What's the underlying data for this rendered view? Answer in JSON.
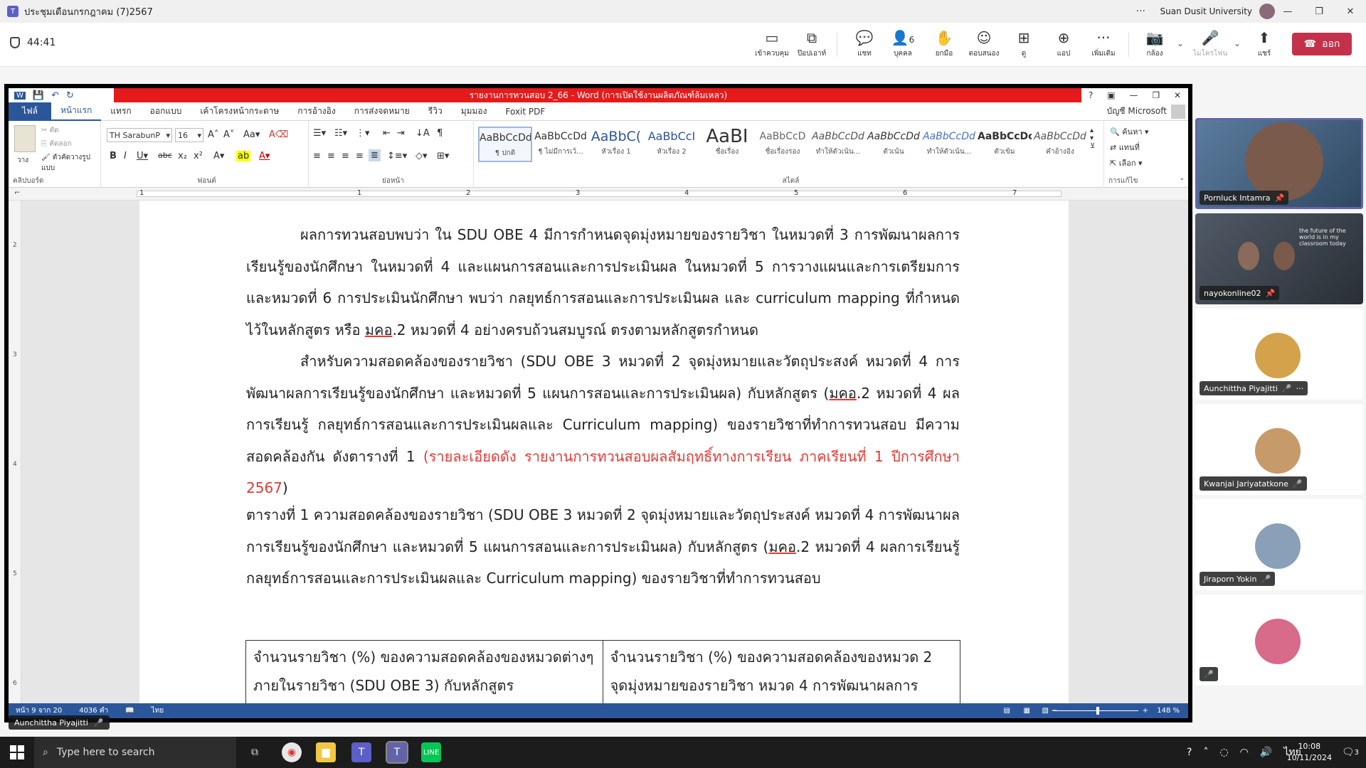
{
  "teams": {
    "title": "ประชุมเดือนกรกฎาคม (7)2567",
    "org": "Suan Dusit University",
    "more": "···",
    "timer": "44:41",
    "toolbar": [
      {
        "id": "take-control",
        "label": "เข้าควบคุม",
        "icon": "▭"
      },
      {
        "id": "popout",
        "label": "ป๊อปเอาท์",
        "icon": "⧉"
      },
      {
        "id": "chat",
        "label": "แชท",
        "icon": "💬"
      },
      {
        "id": "people",
        "label": "บุคคล",
        "icon": "👤",
        "count": "6"
      },
      {
        "id": "raise-hand",
        "label": "ยกมือ",
        "icon": "✋"
      },
      {
        "id": "react",
        "label": "ตอบสนอง",
        "icon": "☺"
      },
      {
        "id": "view",
        "label": "ดู",
        "icon": "⊞"
      },
      {
        "id": "apps",
        "label": "แอป",
        "icon": "⊕"
      },
      {
        "id": "more",
        "label": "เพิ่มเติม",
        "icon": "···"
      },
      {
        "id": "camera",
        "label": "กล้อง",
        "icon": "📷"
      },
      {
        "id": "mic",
        "label": "ไมโครโฟน",
        "icon": "🎤"
      },
      {
        "id": "share",
        "label": "แชร์",
        "icon": "⬆"
      }
    ],
    "leave": "ออก"
  },
  "word": {
    "title": "รายงานการทวนสอบ 2_66 - Word (การเปิดใช้งานผลิตภัณฑ์ล้มเหลว)",
    "tabs": [
      "ไฟล์",
      "หน้าแรก",
      "แทรก",
      "ออกแบบ",
      "เค้าโครงหน้ากระดาษ",
      "การอ้างอิง",
      "การส่งจดหมาย",
      "รีวิว",
      "มุมมอง",
      "Foxit PDF"
    ],
    "account": "บัญชี Microsoft",
    "font_name": "TH SarabunP",
    "font_size": "16",
    "clipboard": {
      "paste": "วาง",
      "cut": "ตัด",
      "copy": "คัดลอก",
      "format_painter": "ตัวคัดวางรูปแบบ",
      "label": "คลิปบอร์ด"
    },
    "group_font": "ฟอนต์",
    "group_paragraph": "ย่อหน้า",
    "group_styles": "สไตล์",
    "group_editing": "การแก้ไข",
    "editing": {
      "find": "ค้นหา",
      "replace": "แทนที่",
      "select": "เลือก"
    },
    "styles": [
      {
        "preview": "AaBbCcDd",
        "name": "¶ ปกติ"
      },
      {
        "preview": "AaBbCcDd",
        "name": "¶ ไม่มีการเว้..."
      },
      {
        "preview": "AaBbC(",
        "name": "หัวเรื่อง 1"
      },
      {
        "preview": "AaBbCcI",
        "name": "หัวเรื่อง 2"
      },
      {
        "preview": "AaBI",
        "name": "ชื่อเรื่อง"
      },
      {
        "preview": "AaBbCcD",
        "name": "ชื่อเรื่องรอง"
      },
      {
        "preview": "AaBbCcDd",
        "name": "ทำให้ตัวเน้น..."
      },
      {
        "preview": "AaBbCcDd",
        "name": "ตัวเน้น"
      },
      {
        "preview": "AaBbCcDd",
        "name": "ทำให้ตัวเน้น..."
      },
      {
        "preview": "AaBbCcDc",
        "name": "ตัวเข้ม"
      },
      {
        "preview": "AaBbCcDd",
        "name": "คำอ้างอิง"
      }
    ],
    "ruler": [
      "1",
      "1",
      "2",
      "3",
      "4",
      "5",
      "6",
      "7"
    ],
    "vruler": [
      "2",
      "3",
      "4",
      "5",
      "6"
    ],
    "doc": {
      "p1": "ผลการทวนสอบพบว่า ใน SDU OBE 4 มีการกำหนดจุดมุ่งหมายของรายวิชา ในหมวดที่ 3 การพัฒนาผลการเรียนรู้ของนักศึกษา ในหมวดที่ 4 และแผนการสอนและการประเมินผล ในหมวดที่ 5 การวางแผนและการเตรียมการ และหมวดที่ 6 การประเมินนักศึกษา พบว่า  กลยุทธ์การสอนและการประเมินผล และ curriculum mapping ที่กำหนดไว้ในหลักสูตร หรือ",
      "p1_u": "มคอ",
      "p1_end": ".2 หมวดที่ 4 อย่างครบถ้วนสมบูรณ์ ตรงตามหลักสูตรกำหนด",
      "p2a": "สำหรับความสอดคล้องของรายวิชา (SDU OBE 3 หมวดที่ 2 จุดมุ่งหมายและวัตถุประสงค์ หมวดที่ 4 การพัฒนาผลการเรียนรู้ของนักศึกษา และหมวดที่ 5 แผนการสอนและการประเมินผล) กับหลักสูตร (",
      "p2_u": "มคอ",
      "p2b": ".2 หมวดที่ 4 ผลการเรียนรู้ กลยุทธ์การสอนและการประเมินผลและ Curriculum mapping) ของรายวิชาที่ทำการทวนสอบ มีความสอดคล้องกัน ดังตารางที่ 1 ",
      "p2_red": "(รายละเอียดดัง รายงานการทวนสอบผลสัมฤทธิ์ทางการเรียน ภาคเรียนที่ 1 ปีการศึกษา 2567",
      "p2_close": ")",
      "p3a": "ตารางที่ 1 ความสอดคล้องของรายวิชา (SDU OBE 3 หมวดที่ 2 จุดมุ่งหมายและวัตถุประสงค์ หมวดที่ 4 การพัฒนาผลการเรียนรู้ของนักศึกษา และหมวดที่ 5 แผนการสอนและการประเมินผล) กับหลักสูตร (",
      "p3_u": "มคอ",
      "p3b": ".2 หมวดที่ 4 ผลการเรียนรู้ กลยุทธ์การสอนและการประเมินผลและ Curriculum mapping) ของรายวิชาที่ทำการทวนสอบ",
      "table_c1": "จำนวนรายวิชา (%) ของความสอดคล้องของหมวดต่างๆ ภายในรายวิชา (SDU OBE 3) กับหลักสูตร",
      "table_c2": "จำนวนรายวิชา (%) ของความสอดคล้องของหมวด 2 จุดมุ่งหมายของรายวิชา หมวด 4 การพัฒนาผลการ"
    },
    "status": {
      "page": "หน้า 9 จาก 20",
      "words": "4036 คำ",
      "lang": "ไทย",
      "zoom": "148 %"
    }
  },
  "presenter_tag": "Aunchittha Piyajitti",
  "participants": [
    {
      "name": "Pornluck Intamra",
      "video": true,
      "color": "#4a6a8a"
    },
    {
      "name": "nayokonline02",
      "video": true,
      "color": "#3b4450"
    },
    {
      "name": "Aunchittha Piyajitti",
      "video": false,
      "color": "#d4a24a",
      "more": "···"
    },
    {
      "name": "Kwanjai Jariyatatkone",
      "video": false,
      "color": "#c79a6a"
    },
    {
      "name": "Jiraporn Yokin",
      "video": false,
      "color": "#8aa0b8"
    },
    {
      "name": "",
      "video": false,
      "color": "#d86a8a"
    }
  ],
  "video_overlay": "the future of the world is in my classroom today",
  "taskbar": {
    "search_placeholder": "Type here to search",
    "time": "10:08",
    "date": "10/11/2024",
    "lang": "ไทย",
    "notif": "3"
  }
}
